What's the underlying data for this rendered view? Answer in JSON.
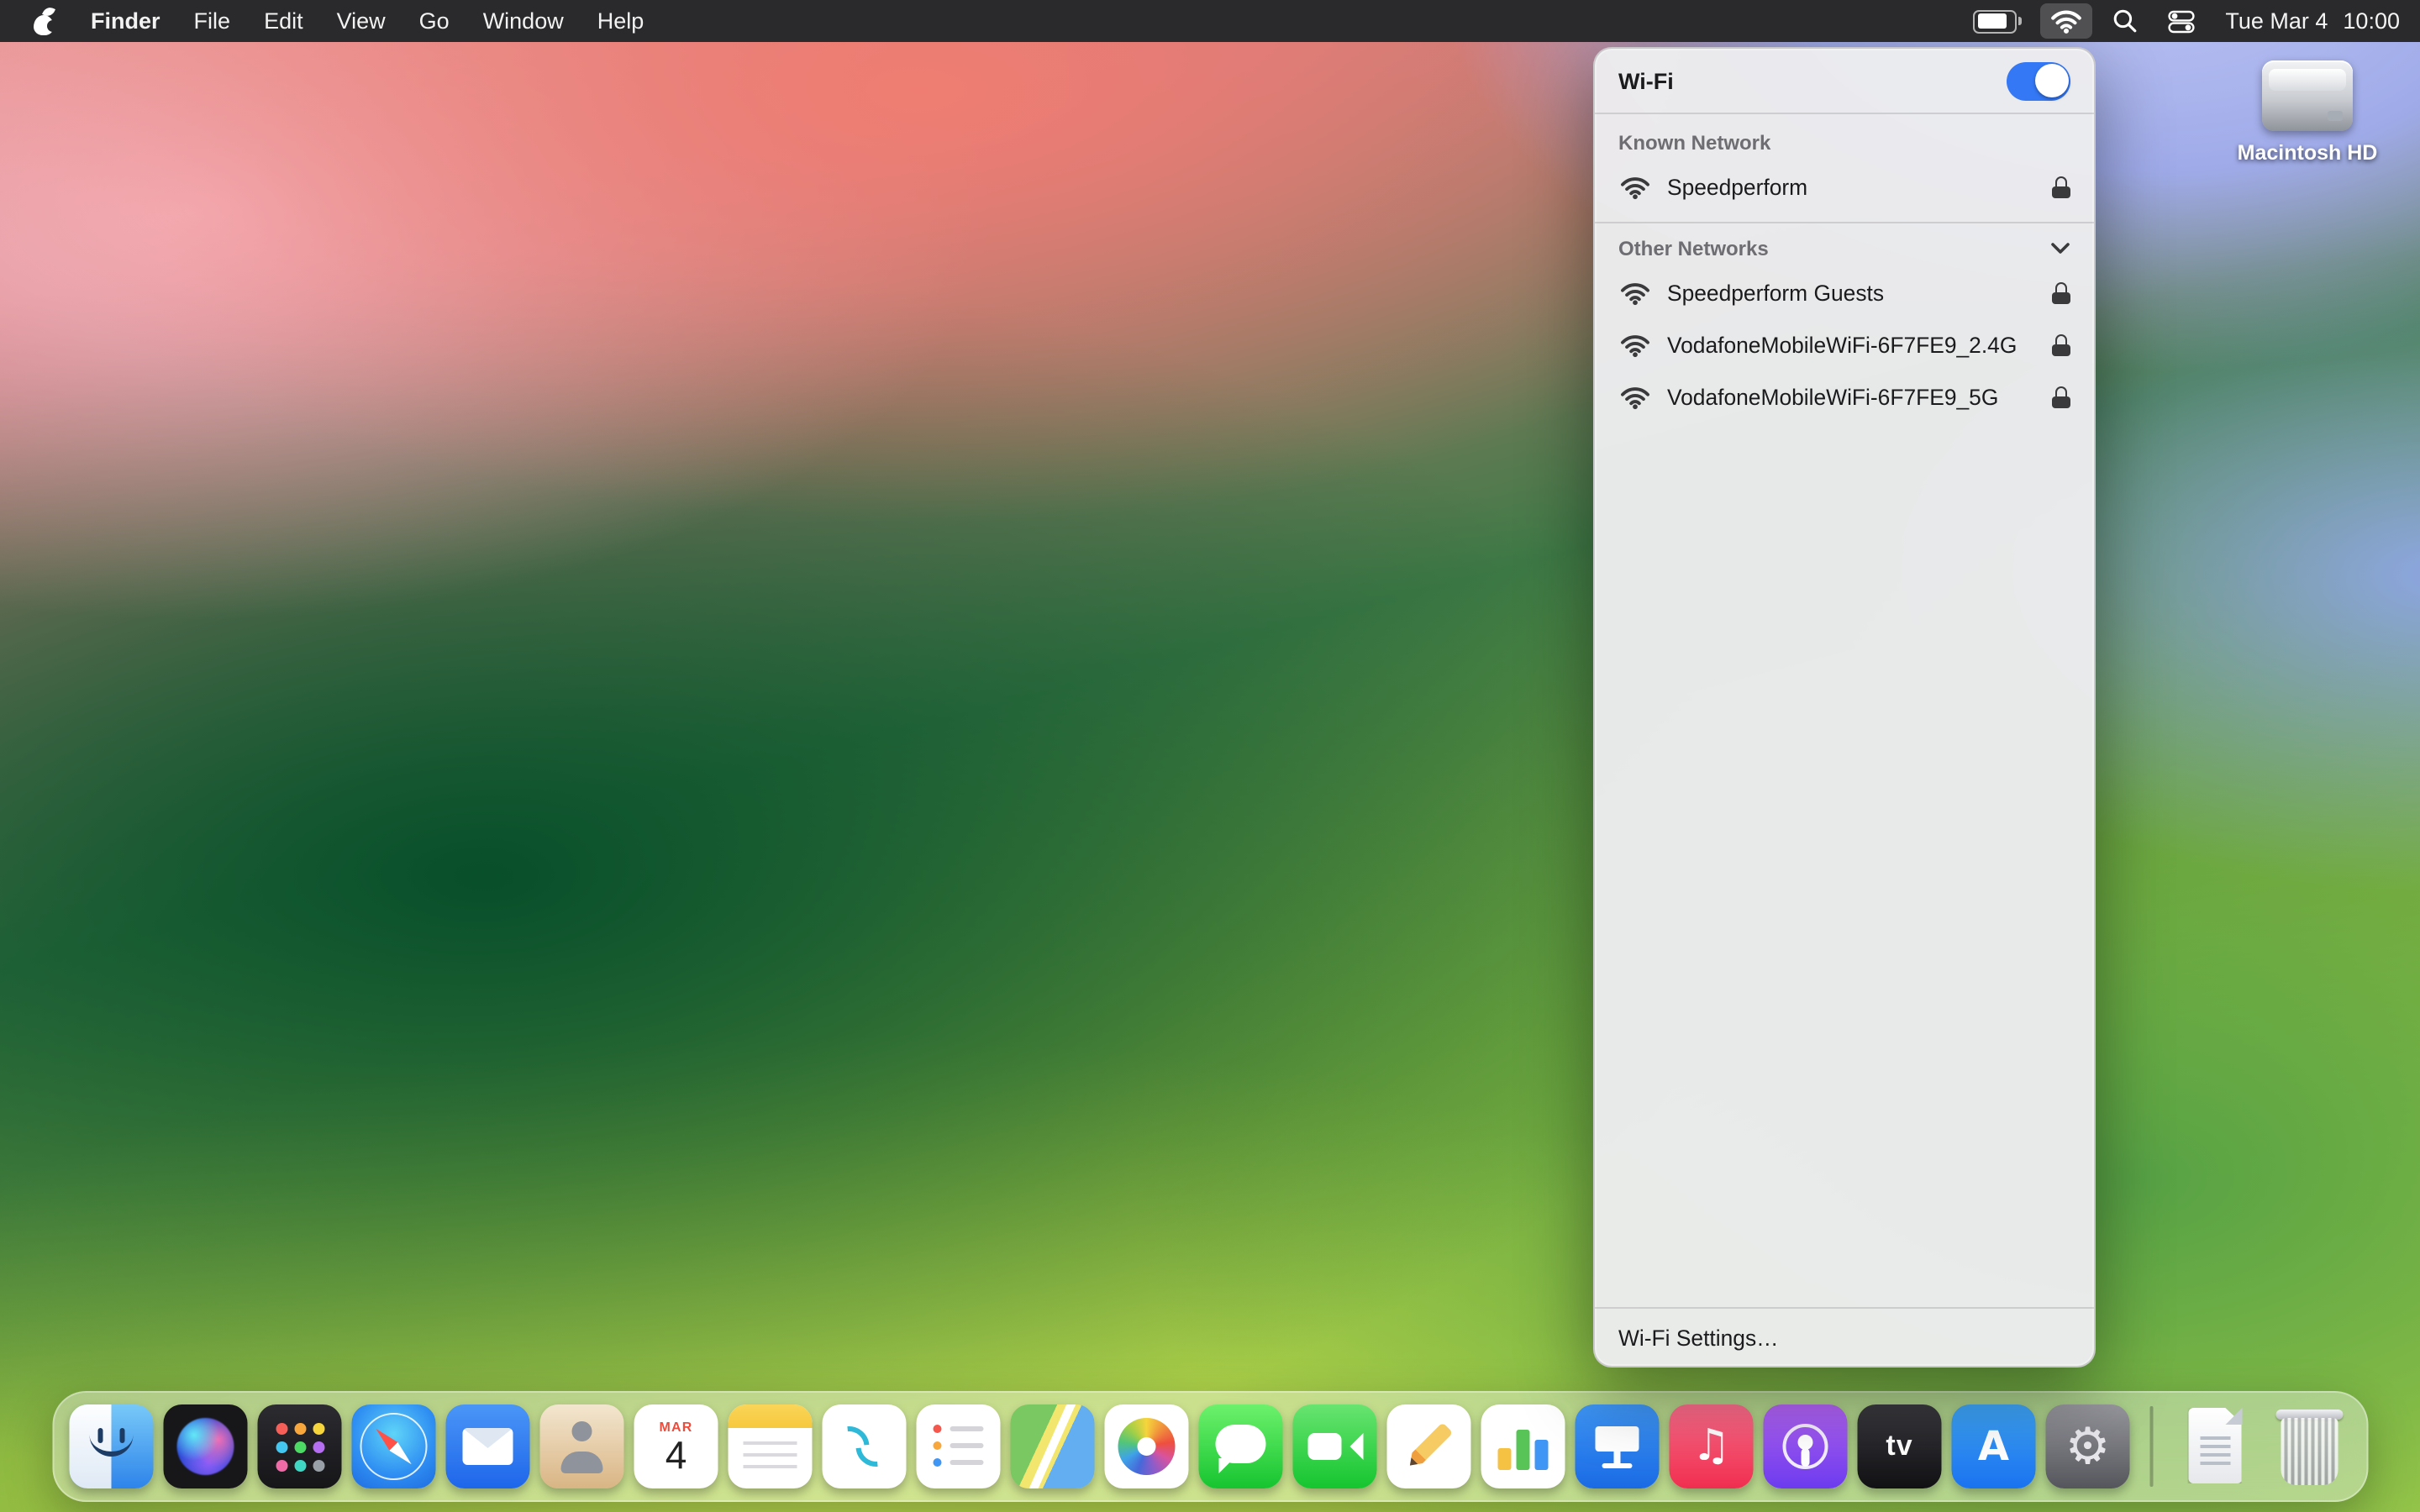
{
  "menu_bar": {
    "apple_menu_icon": "apple-logo-icon",
    "items": [
      "Finder",
      "File",
      "Edit",
      "View",
      "Go",
      "Window",
      "Help"
    ],
    "status_icons": [
      "battery-icon",
      "wifi-icon",
      "spotlight-search-icon",
      "control-center-icon"
    ],
    "clock": {
      "date": "Tue Mar 4",
      "time": "10:00"
    }
  },
  "wifi_popover": {
    "title": "Wi-Fi",
    "toggle": {
      "state": "on",
      "accent_color": "#3478f6"
    },
    "known_header": "Known Network",
    "known_networks": [
      {
        "name": "Speedperform",
        "secured": true,
        "icon": "wifi-icon"
      }
    ],
    "other_header": "Other Networks",
    "other_collapse_icon": "chevron-down-icon",
    "other_networks": [
      {
        "name": "Speedperform Guests",
        "secured": true,
        "icon": "wifi-icon"
      },
      {
        "name": "VodafoneMobileWiFi-6F7FE9_2.4G",
        "secured": true,
        "icon": "wifi-icon"
      },
      {
        "name": "VodafoneMobileWiFi-6F7FE9_5G",
        "secured": true,
        "icon": "wifi-icon"
      }
    ],
    "settings_label": "Wi-Fi Settings…"
  },
  "desktop": {
    "volumes": [
      {
        "label": "Macintosh HD",
        "icon": "hard-drive-icon"
      }
    ]
  },
  "dock": {
    "apps": [
      {
        "id": "finder",
        "label": "Finder",
        "icon": "finder-face-icon"
      },
      {
        "id": "siri",
        "label": "Siri",
        "icon": "siri-orb-icon"
      },
      {
        "id": "launchpad",
        "label": "Launchpad",
        "icon": "app-grid-icon"
      },
      {
        "id": "safari",
        "label": "Safari",
        "icon": "compass-icon"
      },
      {
        "id": "mail",
        "label": "Mail",
        "icon": "envelope-icon"
      },
      {
        "id": "contacts",
        "label": "Contacts",
        "icon": "person-silhouette-icon"
      },
      {
        "id": "calendar",
        "label": "Calendar",
        "icon": "calendar-page-icon",
        "month": "MAR",
        "day": "4"
      },
      {
        "id": "notes",
        "label": "Notes",
        "icon": "notepad-icon"
      },
      {
        "id": "freeform",
        "label": "Freeform",
        "icon": "scribble-icon"
      },
      {
        "id": "reminders",
        "label": "Reminders",
        "icon": "checklist-icon"
      },
      {
        "id": "maps",
        "label": "Maps",
        "icon": "map-icon"
      },
      {
        "id": "photos",
        "label": "Photos",
        "icon": "color-pinwheel-icon"
      },
      {
        "id": "messages",
        "label": "Messages",
        "icon": "speech-bubble-icon"
      },
      {
        "id": "facetime",
        "label": "FaceTime",
        "icon": "video-camera-icon"
      },
      {
        "id": "pages",
        "label": "Pages",
        "icon": "pen-icon"
      },
      {
        "id": "numbers",
        "label": "Numbers",
        "icon": "bar-chart-icon"
      },
      {
        "id": "keynote",
        "label": "Keynote",
        "icon": "podium-icon"
      },
      {
        "id": "music",
        "label": "Music",
        "icon": "music-note-icon",
        "glyph": "♫"
      },
      {
        "id": "podcasts",
        "label": "Podcasts",
        "icon": "podcasts-icon"
      },
      {
        "id": "tv",
        "label": "TV",
        "icon": "tv-icon",
        "glyph": "tv"
      },
      {
        "id": "appstore",
        "label": "App Store",
        "icon": "app-store-a-icon",
        "glyph": "A"
      },
      {
        "id": "settings",
        "label": "System Settings",
        "icon": "gear-icon",
        "glyph": "⚙"
      },
      {
        "id": "divider",
        "divider": true
      },
      {
        "id": "document",
        "label": "Document",
        "icon": "document-icon"
      },
      {
        "id": "trash",
        "label": "Trash",
        "icon": "trash-basket-icon"
      }
    ]
  }
}
